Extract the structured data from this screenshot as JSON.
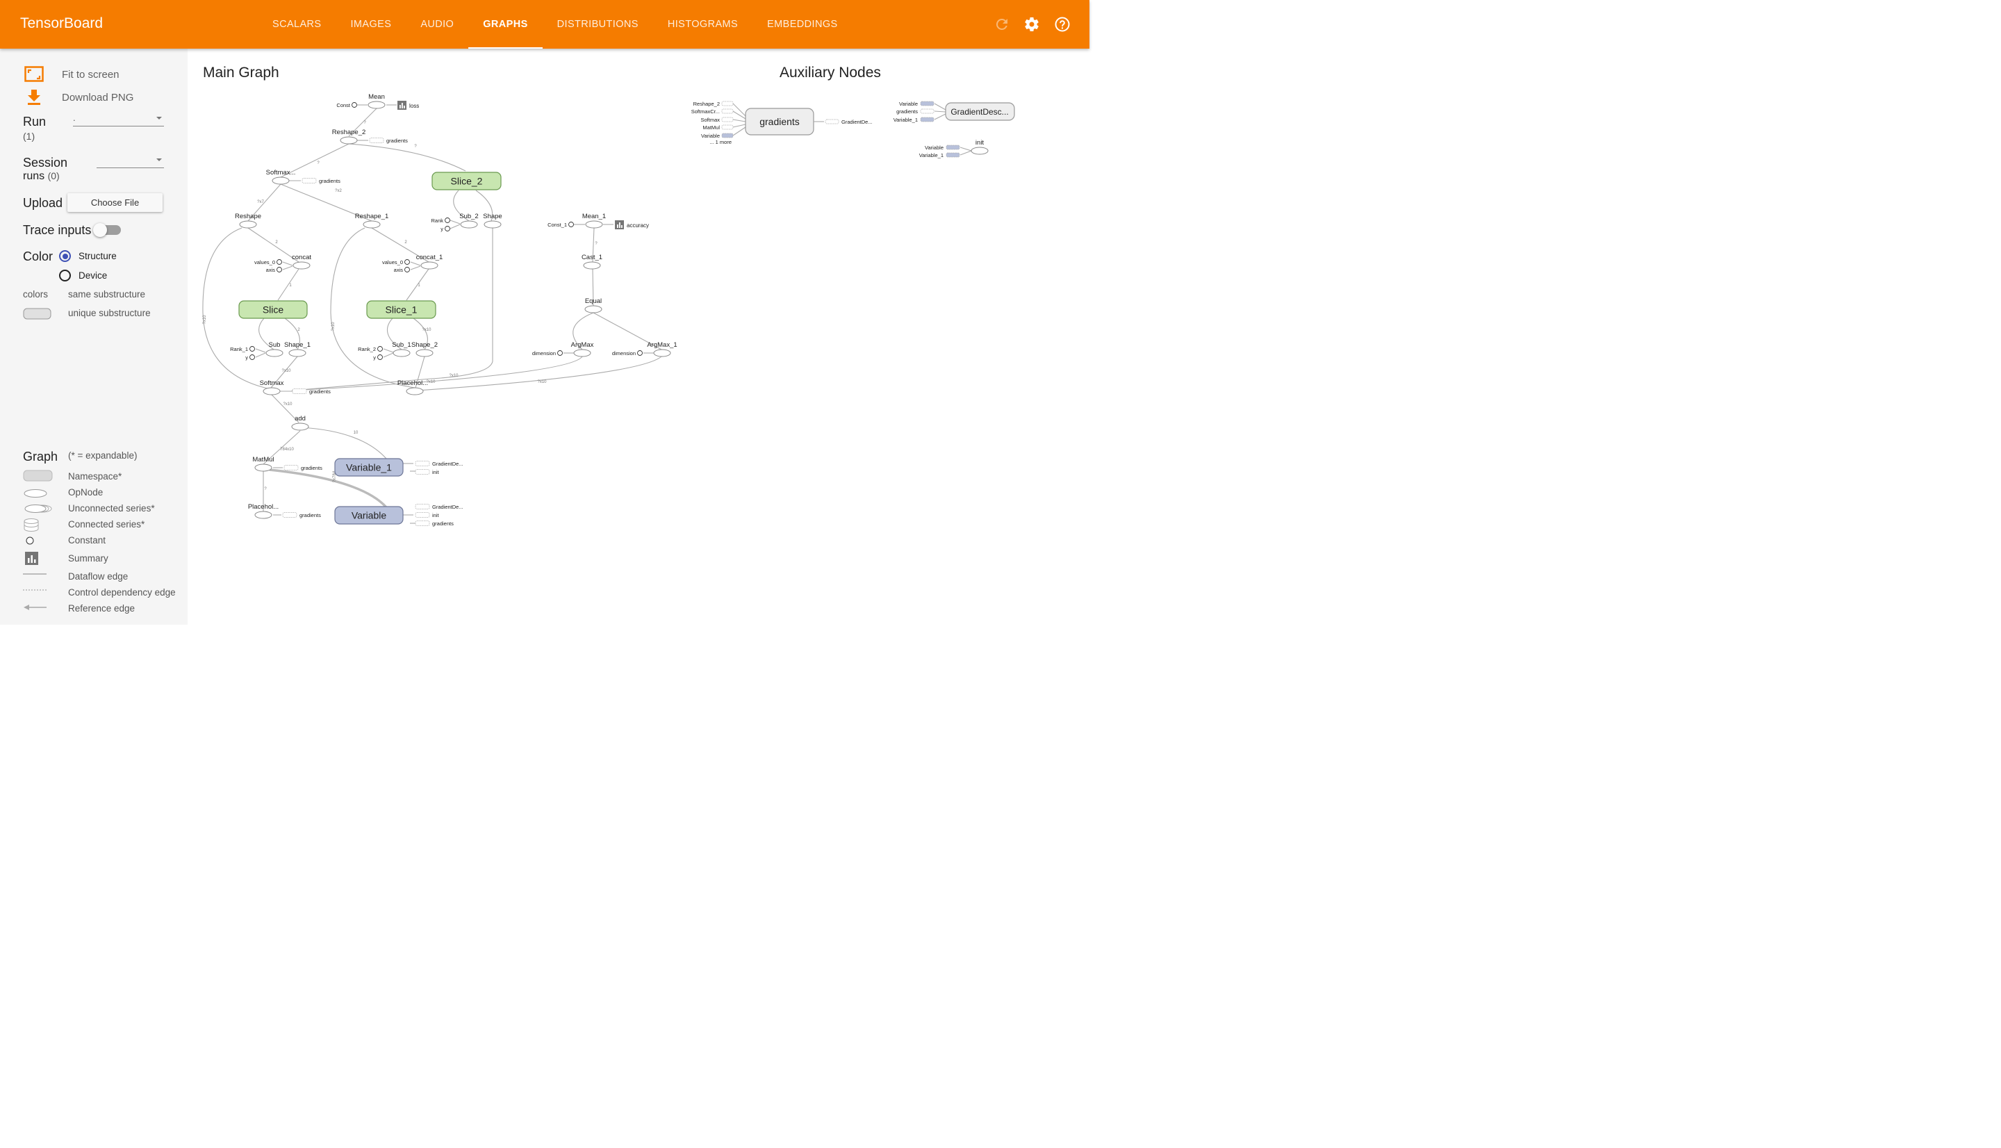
{
  "header": {
    "brand": "TensorBoard",
    "tabs": [
      {
        "label": "SCALARS"
      },
      {
        "label": "IMAGES"
      },
      {
        "label": "AUDIO"
      },
      {
        "label": "GRAPHS"
      },
      {
        "label": "DISTRIBUTIONS"
      },
      {
        "label": "HISTOGRAMS"
      },
      {
        "label": "EMBEDDINGS"
      }
    ],
    "active_tab": "GRAPHS",
    "icons": [
      "refresh-icon",
      "settings-icon",
      "help-icon"
    ]
  },
  "sidebar": {
    "fit_label": "Fit to screen",
    "download_label": "Download PNG",
    "run_label": "Run",
    "run_count": "(1)",
    "run_value": ".",
    "session_label1": "Session",
    "session_label2": "runs",
    "session_count": "(0)",
    "upload_label": "Upload",
    "choose_file": "Choose File",
    "trace_label": "Trace inputs",
    "trace_on": false,
    "color_label": "Color",
    "color_options": [
      "Structure",
      "Device"
    ],
    "color_selected": "Structure",
    "colors_label": "colors",
    "same_sub": "same substructure",
    "unique_sub": "unique substructure",
    "graph_label": "Graph",
    "expandable_note": "(* = expandable)",
    "legend": [
      "Namespace*",
      "OpNode",
      "Unconnected series*",
      "Connected series*",
      "Constant",
      "Summary",
      "Dataflow edge",
      "Control dependency edge",
      "Reference edge"
    ]
  },
  "main": {
    "title": "Main Graph",
    "aux_title": "Auxiliary Nodes"
  },
  "graph": {
    "namespaces": [
      "Slice_2",
      "Slice",
      "Slice_1"
    ],
    "variables": [
      "Variable_1",
      "Variable"
    ],
    "ops": [
      "Mean",
      "Reshape_2",
      "Softmax...",
      "Reshape",
      "Reshape_1",
      "concat",
      "concat_1",
      "Sub",
      "Shape_1",
      "Sub_1",
      "Shape_2",
      "Sub_2",
      "Shape",
      "Mean_1",
      "Cast_1",
      "Equal",
      "ArgMax",
      "ArgMax_1",
      "Softmax",
      "Placehol...",
      "add",
      "MatMul",
      "Placehol..."
    ],
    "constants": [
      "Const",
      "Const_1",
      "values_0",
      "axis",
      "values_0",
      "axis",
      "Rank",
      "y",
      "Rank_1",
      "y",
      "Rank_2",
      "y",
      "dimension",
      "dimension"
    ],
    "summaries": [
      "loss",
      "accuracy"
    ],
    "side_labels": [
      "gradients",
      "gradients",
      "gradients",
      "gradients",
      "gradients",
      "gradients",
      "GradientDe...",
      "init",
      "GradientDe...",
      "init",
      "gradients",
      "... 1 more"
    ],
    "edge_labels": [
      "?",
      "?",
      "?",
      "?x2",
      "?x7",
      "2",
      "1",
      "2",
      "1",
      "2",
      "?x10",
      "?x10",
      "?x10",
      "?x10",
      "?x10",
      "?x10",
      "10",
      "?x10",
      "?x10",
      "784x10",
      "?x784",
      "?",
      "?"
    ],
    "aux": {
      "gradients_inputs": [
        "Reshape_2",
        "SoftmaxCr...",
        "Softmax",
        "MatMul",
        "Variable",
        "... 1 more"
      ],
      "gradients_node": "gradients",
      "gradients_output": "GradientDe...",
      "gd_inputs": [
        "Variable",
        "gradients",
        "Variable_1"
      ],
      "gd_node": "GradientDesc...",
      "init_inputs": [
        "Variable",
        "Variable_1"
      ],
      "init_node": "init"
    }
  },
  "colors": {
    "header": "#f57c00",
    "sidebar": "#f5f5f5",
    "namespace_green": "#c8e6b0",
    "variable_blue": "#b8c1db",
    "radio_selected": "#3f51b5"
  }
}
